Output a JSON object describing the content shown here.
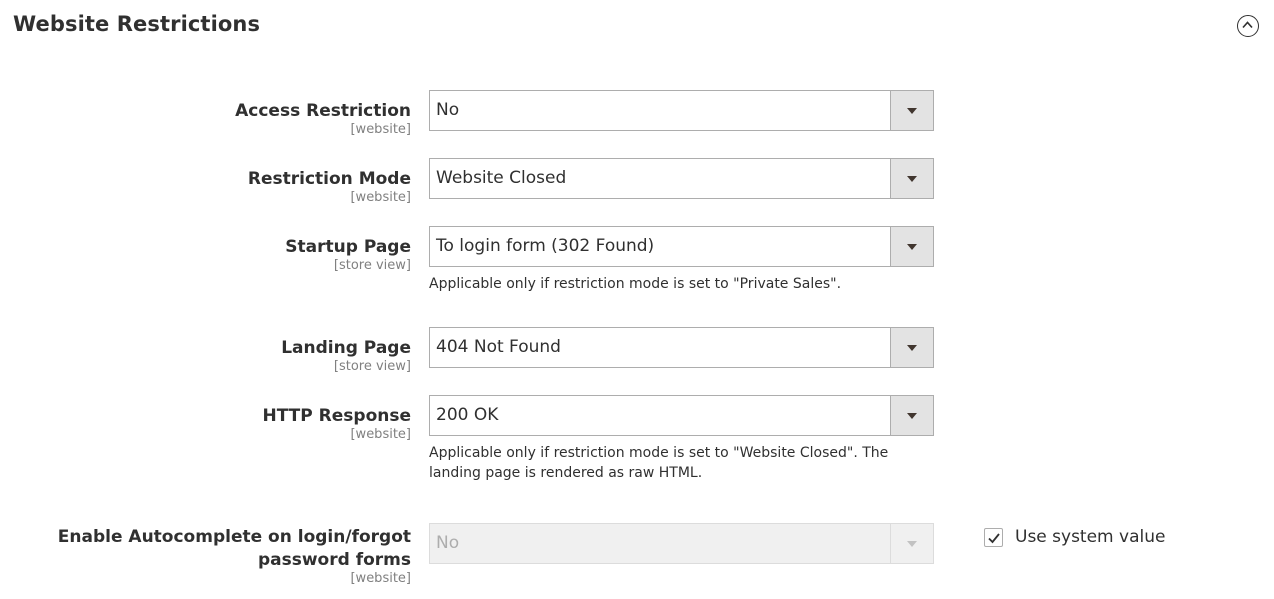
{
  "section": {
    "title": "Website Restrictions",
    "collapse_icon": "chevron-up-circle-icon"
  },
  "fields": [
    {
      "label": "Access Restriction",
      "scope": "[website]",
      "value": "No"
    },
    {
      "label": "Restriction Mode",
      "scope": "[website]",
      "value": "Website Closed"
    },
    {
      "label": "Startup Page",
      "scope": "[store view]",
      "value": "To login form (302 Found)",
      "note": "Applicable only if restriction mode is set to \"Private Sales\"."
    },
    {
      "label": "Landing Page",
      "scope": "[store view]",
      "value": "404 Not Found"
    },
    {
      "label": "HTTP Response",
      "scope": "[website]",
      "value": "200 OK",
      "note": "Applicable only if restriction mode is set to \"Website Closed\". The landing page is rendered as raw HTML."
    },
    {
      "label": "Enable Autocomplete on login/forgot password forms",
      "scope": "[website]",
      "value": "No",
      "disabled": true,
      "use_system_value_label": "Use system value",
      "use_system_value_checked": true
    }
  ]
}
